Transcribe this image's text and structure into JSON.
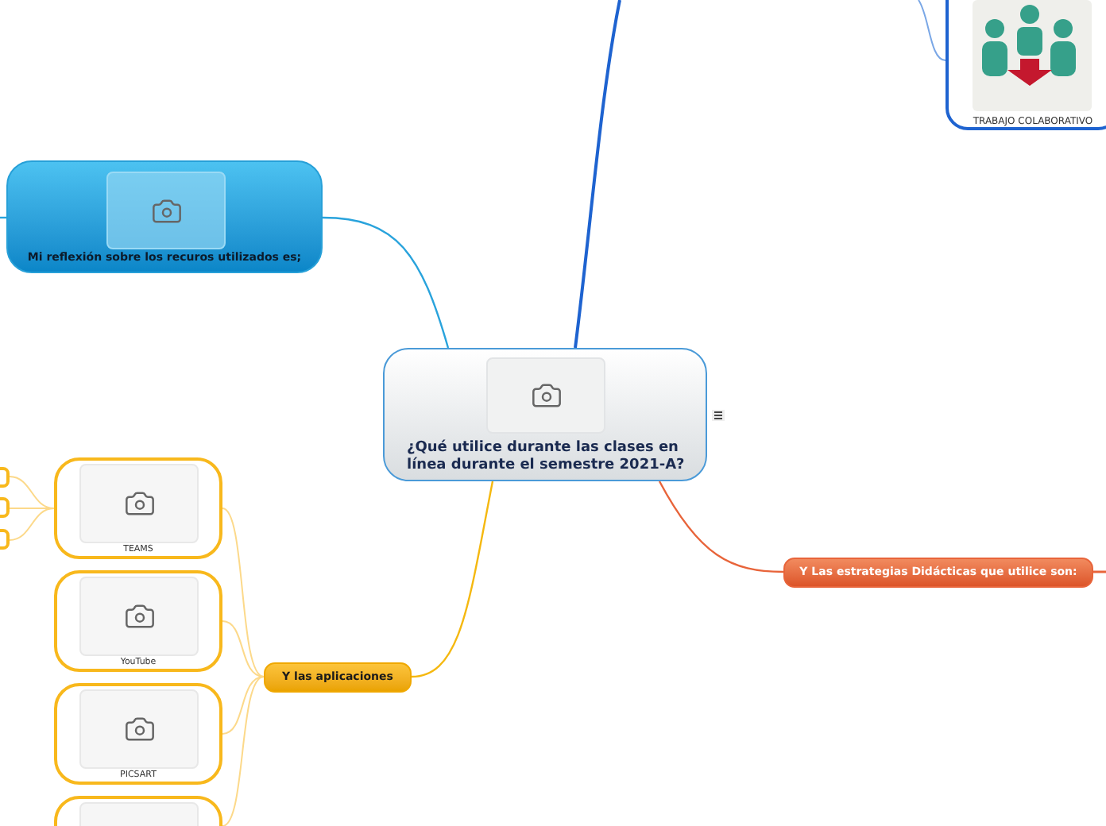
{
  "central_topic": {
    "title": "¿Qué utilice durante las clases en línea durante el semestre 2021-A?"
  },
  "reflection_node": {
    "title": "Mi reflexión sobre los recuros utilizados es;"
  },
  "collaboration_node": {
    "caption": "TRABAJO COLABORATIVO"
  },
  "strategies_node": {
    "title": "Y Las estrategias Didácticas que utilice son:"
  },
  "apps_node": {
    "title": "Y las aplicaciones",
    "apps": [
      {
        "label": "TEAMS"
      },
      {
        "label": "YouTube"
      },
      {
        "label": "PICSART"
      }
    ]
  }
}
